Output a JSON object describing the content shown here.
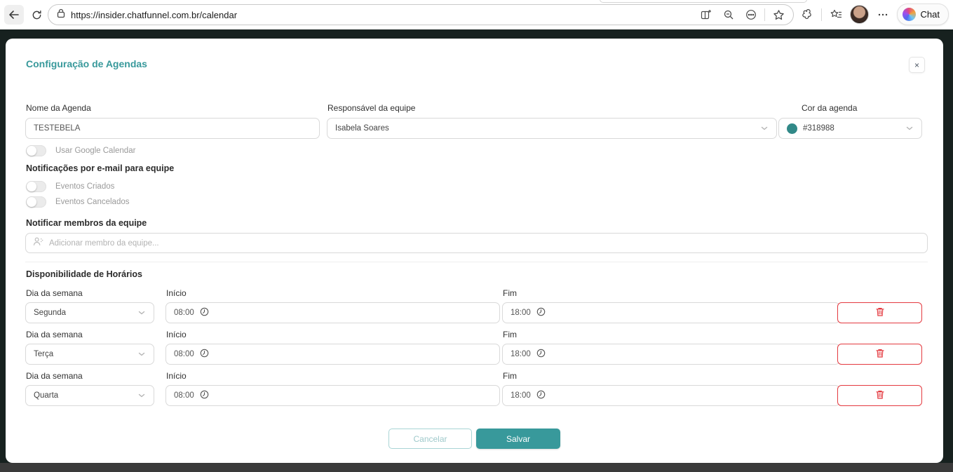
{
  "browser": {
    "url": "https://insider.chatfunnel.com.br/calendar",
    "chat_label": "Chat"
  },
  "modal": {
    "title": "Configuração de Agendas",
    "close_label": "×",
    "fields": {
      "name": {
        "label": "Nome da Agenda",
        "value": "TESTEBELA"
      },
      "owner": {
        "label": "Responsável da equipe",
        "value": "Isabela Soares"
      },
      "color": {
        "label": "Cor da agenda",
        "value": "#318988"
      }
    },
    "google_toggle_label": "Usar Google Calendar",
    "notifications": {
      "heading": "Notificações por e-mail para equipe",
      "toggle_created": "Eventos Criados",
      "toggle_cancelled": "Eventos Cancelados"
    },
    "members": {
      "heading": "Notificar membros da equipe",
      "placeholder": "Adicionar membro da equipe..."
    },
    "availability": {
      "heading": "Disponibilidade de Horários",
      "day_label": "Dia da semana",
      "start_label": "Início",
      "end_label": "Fim",
      "rows": [
        {
          "day": "Segunda",
          "start": "08:00",
          "end": "18:00"
        },
        {
          "day": "Terça",
          "start": "08:00",
          "end": "18:00"
        },
        {
          "day": "Quarta",
          "start": "08:00",
          "end": "18:00"
        }
      ]
    },
    "actions": {
      "cancel": "Cancelar",
      "save": "Salvar"
    }
  },
  "colors": {
    "accent": "#38999b",
    "agenda_swatch": "#318988",
    "danger": "#e4393f"
  }
}
